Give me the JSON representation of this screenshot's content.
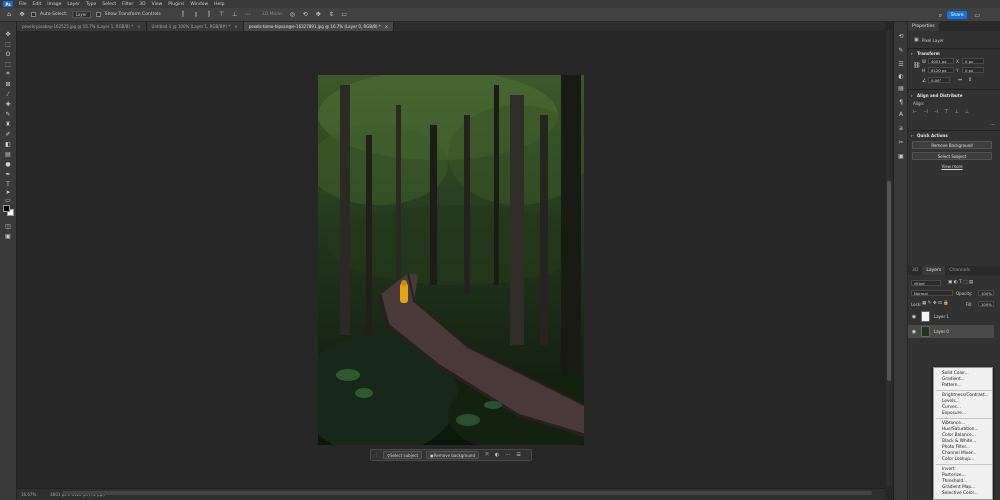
{
  "menubar": {
    "app_logo": "Ps",
    "items": [
      "File",
      "Edit",
      "Image",
      "Layer",
      "Type",
      "Select",
      "Filter",
      "3D",
      "View",
      "Plugins",
      "Window",
      "Help"
    ]
  },
  "options_bar": {
    "auto_select_label": "Auto-Select:",
    "auto_select_value": "Layer",
    "transform_controls_label": "Show Transform Controls",
    "mode_label": "3D Mode:",
    "share_label": "Share"
  },
  "doc_tabs": [
    {
      "label": "pexels-pixabay-162525.jpg @ 16.7% (Layer 1, RGB/8) *",
      "active": false
    },
    {
      "label": "Untitled-1 @ 100% (Layer 1, RGB/8#) *",
      "active": false
    },
    {
      "label": "pexels-tomo-hipsan@e-16327891.jpg @ 16.7% (Layer 0, RGB/8) *",
      "active": true
    }
  ],
  "contextual_bar": {
    "select_subject": "Select subject",
    "remove_background": "Remove background"
  },
  "status_bar": {
    "zoom": "16.67%",
    "doc_info": "4001 px x 6120 px (72 ppi)"
  },
  "properties": {
    "tab": "Properties",
    "layer_type": "Pixel Layer",
    "transform_title": "Transform",
    "w_label": "W",
    "w_value": "4001 px",
    "h_label": "H",
    "h_value": "6120 px",
    "x_label": "X",
    "x_value": "0 px",
    "y_label": "Y",
    "y_value": "0 px",
    "angle_value": "0.00°",
    "align_title": "Align and Distribute",
    "align_label": "Align:",
    "quick_actions_title": "Quick Actions",
    "remove_bg_button": "Remove Background",
    "select_subject_button": "Select Subject",
    "view_more_link": "View more"
  },
  "layers": {
    "tabs": [
      "3D",
      "Layers",
      "Channels"
    ],
    "active_tab": "Layers",
    "kind_label": "Kind",
    "blend_mode": "Normal",
    "opacity_label": "Opacity:",
    "opacity_value": "100%",
    "lock_label": "Lock:",
    "fill_label": "Fill:",
    "fill_value": "100%",
    "rows": [
      {
        "name": "Layer 1",
        "selected": false
      },
      {
        "name": "Layer 0",
        "selected": true
      }
    ]
  },
  "adjustment_menu": {
    "group1": [
      "Solid Color...",
      "Gradient...",
      "Pattern..."
    ],
    "group2": [
      "Brightness/Contrast...",
      "Levels...",
      "Curves...",
      "Exposure..."
    ],
    "group3": [
      "Vibrance...",
      "Hue/Saturation...",
      "Color Balance...",
      "Black & White...",
      "Photo Filter...",
      "Channel Mixer...",
      "Color Lookup..."
    ],
    "group4": [
      "Invert",
      "Posterize...",
      "Threshold...",
      "Gradient Map...",
      "Selective Color..."
    ]
  },
  "colors": {
    "accent": "#1473e6",
    "panel_bg": "#323232",
    "canvas_bg": "#272727"
  }
}
